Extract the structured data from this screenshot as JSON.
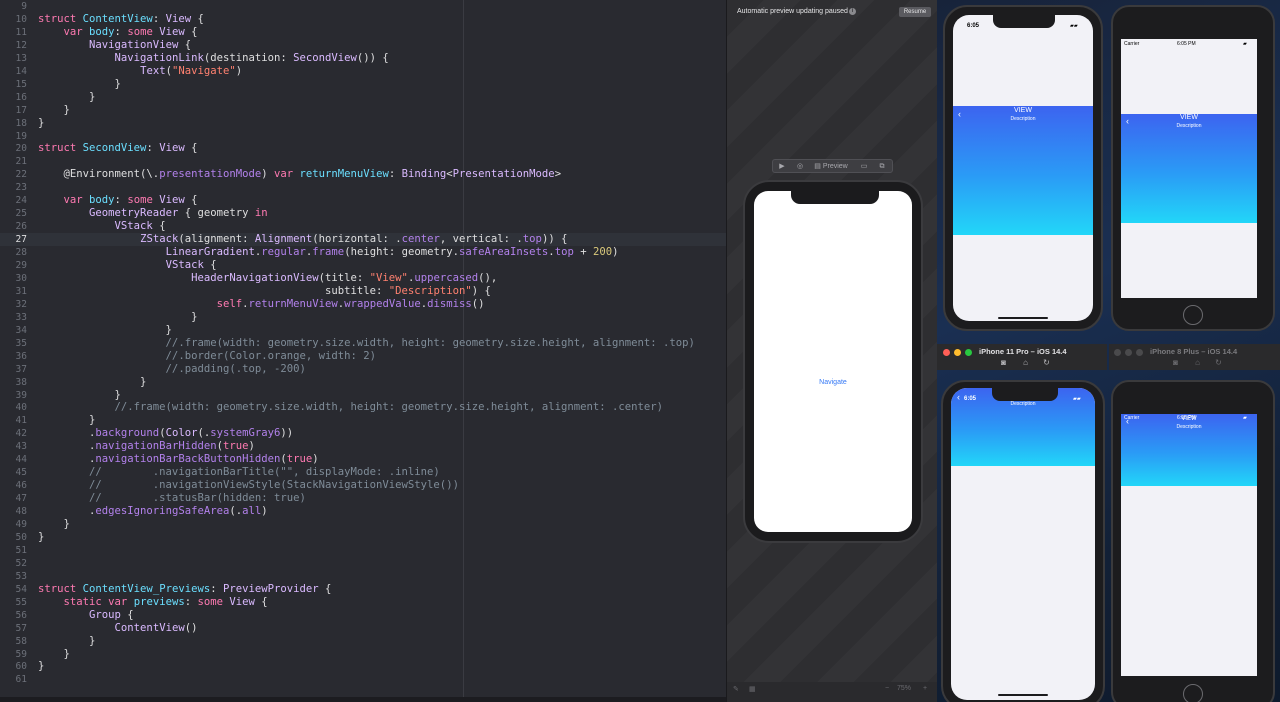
{
  "editor": {
    "current_line": "27",
    "lines": [
      {
        "n": "9",
        "t": []
      },
      {
        "n": "10",
        "t": [
          {
            "c": "kw",
            "s": "struct "
          },
          {
            "c": "df",
            "s": "ContentView"
          },
          {
            "c": "gy",
            "s": ": "
          },
          {
            "c": "ty",
            "s": "View"
          },
          {
            "c": "gy",
            "s": " {"
          }
        ]
      },
      {
        "n": "11",
        "t": [
          {
            "c": "gy",
            "s": "    "
          },
          {
            "c": "kw",
            "s": "var "
          },
          {
            "c": "df",
            "s": "body"
          },
          {
            "c": "gy",
            "s": ": "
          },
          {
            "c": "kw",
            "s": "some "
          },
          {
            "c": "ty",
            "s": "View"
          },
          {
            "c": "gy",
            "s": " {"
          }
        ]
      },
      {
        "n": "12",
        "t": [
          {
            "c": "gy",
            "s": "        "
          },
          {
            "c": "ty",
            "s": "NavigationView"
          },
          {
            "c": "gy",
            "s": " {"
          }
        ]
      },
      {
        "n": "13",
        "t": [
          {
            "c": "gy",
            "s": "            "
          },
          {
            "c": "ty",
            "s": "NavigationLink"
          },
          {
            "c": "gy",
            "s": "(destination: "
          },
          {
            "c": "ty",
            "s": "SecondView"
          },
          {
            "c": "gy",
            "s": "()) {"
          }
        ]
      },
      {
        "n": "14",
        "t": [
          {
            "c": "gy",
            "s": "                "
          },
          {
            "c": "ty",
            "s": "Text"
          },
          {
            "c": "gy",
            "s": "("
          },
          {
            "c": "st",
            "s": "\"Navigate\""
          },
          {
            "c": "gy",
            "s": ")"
          }
        ]
      },
      {
        "n": "15",
        "t": [
          {
            "c": "gy",
            "s": "            }"
          }
        ]
      },
      {
        "n": "16",
        "t": [
          {
            "c": "gy",
            "s": "        }"
          }
        ]
      },
      {
        "n": "17",
        "t": [
          {
            "c": "gy",
            "s": "    }"
          }
        ]
      },
      {
        "n": "18",
        "t": [
          {
            "c": "gy",
            "s": "}"
          }
        ]
      },
      {
        "n": "19",
        "t": []
      },
      {
        "n": "20",
        "t": [
          {
            "c": "kw",
            "s": "struct "
          },
          {
            "c": "df",
            "s": "SecondView"
          },
          {
            "c": "gy",
            "s": ": "
          },
          {
            "c": "ty",
            "s": "View"
          },
          {
            "c": "gy",
            "s": " {"
          }
        ]
      },
      {
        "n": "21",
        "t": []
      },
      {
        "n": "22",
        "t": [
          {
            "c": "gy",
            "s": "    @Environment(\\."
          },
          {
            "c": "pr",
            "s": "presentationMode"
          },
          {
            "c": "gy",
            "s": ") "
          },
          {
            "c": "kw",
            "s": "var "
          },
          {
            "c": "df",
            "s": "returnMenuView"
          },
          {
            "c": "gy",
            "s": ": "
          },
          {
            "c": "ty",
            "s": "Binding"
          },
          {
            "c": "gy",
            "s": "<"
          },
          {
            "c": "ty",
            "s": "PresentationMode"
          },
          {
            "c": "gy",
            "s": ">"
          }
        ]
      },
      {
        "n": "23",
        "t": []
      },
      {
        "n": "24",
        "t": [
          {
            "c": "gy",
            "s": "    "
          },
          {
            "c": "kw",
            "s": "var "
          },
          {
            "c": "df",
            "s": "body"
          },
          {
            "c": "gy",
            "s": ": "
          },
          {
            "c": "kw",
            "s": "some "
          },
          {
            "c": "ty",
            "s": "View"
          },
          {
            "c": "gy",
            "s": " {"
          }
        ]
      },
      {
        "n": "25",
        "t": [
          {
            "c": "gy",
            "s": "        "
          },
          {
            "c": "ty",
            "s": "GeometryReader"
          },
          {
            "c": "gy",
            "s": " { geometry "
          },
          {
            "c": "kw",
            "s": "in"
          }
        ]
      },
      {
        "n": "26",
        "t": [
          {
            "c": "gy",
            "s": "            "
          },
          {
            "c": "ty",
            "s": "VStack"
          },
          {
            "c": "gy",
            "s": " {"
          }
        ]
      },
      {
        "n": "27",
        "t": [
          {
            "c": "gy",
            "s": "                "
          },
          {
            "c": "ty",
            "s": "ZStack"
          },
          {
            "c": "gy",
            "s": "(alignment: "
          },
          {
            "c": "ty",
            "s": "Alignment"
          },
          {
            "c": "gy",
            "s": "(horizontal: ."
          },
          {
            "c": "pr",
            "s": "center"
          },
          {
            "c": "gy",
            "s": ", vertical: ."
          },
          {
            "c": "pr",
            "s": "top"
          },
          {
            "c": "gy",
            "s": ")) {"
          }
        ]
      },
      {
        "n": "28",
        "t": [
          {
            "c": "gy",
            "s": "                    "
          },
          {
            "c": "ty",
            "s": "LinearGradient"
          },
          {
            "c": "gy",
            "s": "."
          },
          {
            "c": "pr",
            "s": "regular"
          },
          {
            "c": "gy",
            "s": "."
          },
          {
            "c": "pr",
            "s": "frame"
          },
          {
            "c": "gy",
            "s": "(height: geometry."
          },
          {
            "c": "pr",
            "s": "safeAreaInsets"
          },
          {
            "c": "gy",
            "s": "."
          },
          {
            "c": "pr",
            "s": "top"
          },
          {
            "c": "gy",
            "s": " + "
          },
          {
            "c": "nu",
            "s": "200"
          },
          {
            "c": "gy",
            "s": ")"
          }
        ]
      },
      {
        "n": "29",
        "t": [
          {
            "c": "gy",
            "s": "                    "
          },
          {
            "c": "ty",
            "s": "VStack"
          },
          {
            "c": "gy",
            "s": " {"
          }
        ]
      },
      {
        "n": "30",
        "t": [
          {
            "c": "gy",
            "s": "                        "
          },
          {
            "c": "ty",
            "s": "HeaderNavigationView"
          },
          {
            "c": "gy",
            "s": "(title: "
          },
          {
            "c": "st",
            "s": "\"View\""
          },
          {
            "c": "gy",
            "s": "."
          },
          {
            "c": "pr",
            "s": "uppercased"
          },
          {
            "c": "gy",
            "s": "(),"
          }
        ]
      },
      {
        "n": "31",
        "t": [
          {
            "c": "gy",
            "s": "                                             subtitle: "
          },
          {
            "c": "st",
            "s": "\"Description\""
          },
          {
            "c": "gy",
            "s": ") {"
          }
        ]
      },
      {
        "n": "32",
        "t": [
          {
            "c": "gy",
            "s": "                            "
          },
          {
            "c": "kw",
            "s": "self"
          },
          {
            "c": "gy",
            "s": "."
          },
          {
            "c": "pr",
            "s": "returnMenuView"
          },
          {
            "c": "gy",
            "s": "."
          },
          {
            "c": "pr",
            "s": "wrappedValue"
          },
          {
            "c": "gy",
            "s": "."
          },
          {
            "c": "pr",
            "s": "dismiss"
          },
          {
            "c": "gy",
            "s": "()"
          }
        ]
      },
      {
        "n": "33",
        "t": [
          {
            "c": "gy",
            "s": "                        }"
          }
        ]
      },
      {
        "n": "34",
        "t": [
          {
            "c": "gy",
            "s": "                    }"
          }
        ]
      },
      {
        "n": "35",
        "t": [
          {
            "c": "cm",
            "s": "                    //.frame(width: geometry.size.width, height: geometry.size.height, alignment: .top)"
          }
        ]
      },
      {
        "n": "36",
        "t": [
          {
            "c": "cm",
            "s": "                    //.border(Color.orange, width: 2)"
          }
        ]
      },
      {
        "n": "37",
        "t": [
          {
            "c": "cm",
            "s": "                    //.padding(.top, -200)"
          }
        ]
      },
      {
        "n": "38",
        "t": [
          {
            "c": "gy",
            "s": "                }"
          }
        ]
      },
      {
        "n": "39",
        "t": [
          {
            "c": "gy",
            "s": "            }"
          }
        ]
      },
      {
        "n": "40",
        "t": [
          {
            "c": "cm",
            "s": "            //.frame(width: geometry.size.width, height: geometry.size.height, alignment: .center)"
          }
        ]
      },
      {
        "n": "41",
        "t": [
          {
            "c": "gy",
            "s": "        }"
          }
        ]
      },
      {
        "n": "42",
        "t": [
          {
            "c": "gy",
            "s": "        ."
          },
          {
            "c": "pr",
            "s": "background"
          },
          {
            "c": "gy",
            "s": "("
          },
          {
            "c": "ty",
            "s": "Color"
          },
          {
            "c": "gy",
            "s": "(."
          },
          {
            "c": "pr",
            "s": "systemGray6"
          },
          {
            "c": "gy",
            "s": "))"
          }
        ]
      },
      {
        "n": "43",
        "t": [
          {
            "c": "gy",
            "s": "        ."
          },
          {
            "c": "pr",
            "s": "navigationBarHidden"
          },
          {
            "c": "gy",
            "s": "("
          },
          {
            "c": "kw",
            "s": "true"
          },
          {
            "c": "gy",
            "s": ")"
          }
        ]
      },
      {
        "n": "44",
        "t": [
          {
            "c": "gy",
            "s": "        ."
          },
          {
            "c": "pr",
            "s": "navigationBarBackButtonHidden"
          },
          {
            "c": "gy",
            "s": "("
          },
          {
            "c": "kw",
            "s": "true"
          },
          {
            "c": "gy",
            "s": ")"
          }
        ]
      },
      {
        "n": "45",
        "t": [
          {
            "c": "cm",
            "s": "        //        .navigationBarTitle(\"\", displayMode: .inline)"
          }
        ]
      },
      {
        "n": "46",
        "t": [
          {
            "c": "cm",
            "s": "        //        .navigationViewStyle(StackNavigationViewStyle())"
          }
        ]
      },
      {
        "n": "47",
        "t": [
          {
            "c": "cm",
            "s": "        //        .statusBar(hidden: true)"
          }
        ]
      },
      {
        "n": "48",
        "t": [
          {
            "c": "gy",
            "s": "        ."
          },
          {
            "c": "pr",
            "s": "edgesIgnoringSafeArea"
          },
          {
            "c": "gy",
            "s": "(."
          },
          {
            "c": "pr",
            "s": "all"
          },
          {
            "c": "gy",
            "s": ")"
          }
        ]
      },
      {
        "n": "49",
        "t": [
          {
            "c": "gy",
            "s": "    }"
          }
        ]
      },
      {
        "n": "50",
        "t": [
          {
            "c": "gy",
            "s": "}"
          }
        ]
      },
      {
        "n": "51",
        "t": []
      },
      {
        "n": "52",
        "t": []
      },
      {
        "n": "53",
        "t": []
      },
      {
        "n": "54",
        "t": [
          {
            "c": "kw",
            "s": "struct "
          },
          {
            "c": "df",
            "s": "ContentView_Previews"
          },
          {
            "c": "gy",
            "s": ": "
          },
          {
            "c": "ty",
            "s": "PreviewProvider"
          },
          {
            "c": "gy",
            "s": " {"
          }
        ]
      },
      {
        "n": "55",
        "t": [
          {
            "c": "gy",
            "s": "    "
          },
          {
            "c": "kw",
            "s": "static var "
          },
          {
            "c": "df",
            "s": "previews"
          },
          {
            "c": "gy",
            "s": ": "
          },
          {
            "c": "kw",
            "s": "some "
          },
          {
            "c": "ty",
            "s": "View"
          },
          {
            "c": "gy",
            "s": " {"
          }
        ]
      },
      {
        "n": "56",
        "t": [
          {
            "c": "gy",
            "s": "        "
          },
          {
            "c": "ty",
            "s": "Group"
          },
          {
            "c": "gy",
            "s": " {"
          }
        ]
      },
      {
        "n": "57",
        "t": [
          {
            "c": "gy",
            "s": "            "
          },
          {
            "c": "ty",
            "s": "ContentView"
          },
          {
            "c": "gy",
            "s": "()"
          }
        ]
      },
      {
        "n": "58",
        "t": [
          {
            "c": "gy",
            "s": "        }"
          }
        ]
      },
      {
        "n": "59",
        "t": [
          {
            "c": "gy",
            "s": "    }"
          }
        ]
      },
      {
        "n": "60",
        "t": [
          {
            "c": "gy",
            "s": "}"
          }
        ]
      },
      {
        "n": "61",
        "t": []
      }
    ]
  },
  "canvas": {
    "banner_text": "Automatic preview updating paused",
    "resume_label": "Resume",
    "preview_button_label": "Preview",
    "navigate_link_text": "Navigate",
    "zoom_label": "75%"
  },
  "simulators": {
    "iphone11": {
      "title": "iPhone 11 Pro – iOS 14.4",
      "time": "6:05",
      "header_title": "VIEW",
      "header_subtitle": "Description",
      "lower_time": "6:05",
      "lower_subtitle": "Description"
    },
    "iphone8": {
      "title": "iPhone 8 Plus – iOS 14.4",
      "carrier": "Carrier",
      "time": "6:05 PM",
      "header_title": "VIEW",
      "header_subtitle": "Description",
      "lower_carrier": "Carrier",
      "lower_time": "6:05 PM",
      "lower_title": "VIEW",
      "lower_subtitle": "Description"
    }
  },
  "colors": {
    "editor_bg": "#292a30",
    "keyword": "#ff7ab2",
    "type": "#dabaff",
    "string": "#ff8170",
    "comment": "#7f8c98",
    "link": "#3478f6",
    "gradient_top": "#3c64f0",
    "gradient_bottom": "#22d6f8",
    "close_dot": "#ff5f57",
    "minimize_dot": "#febc2e",
    "zoom_dot": "#28c840"
  }
}
